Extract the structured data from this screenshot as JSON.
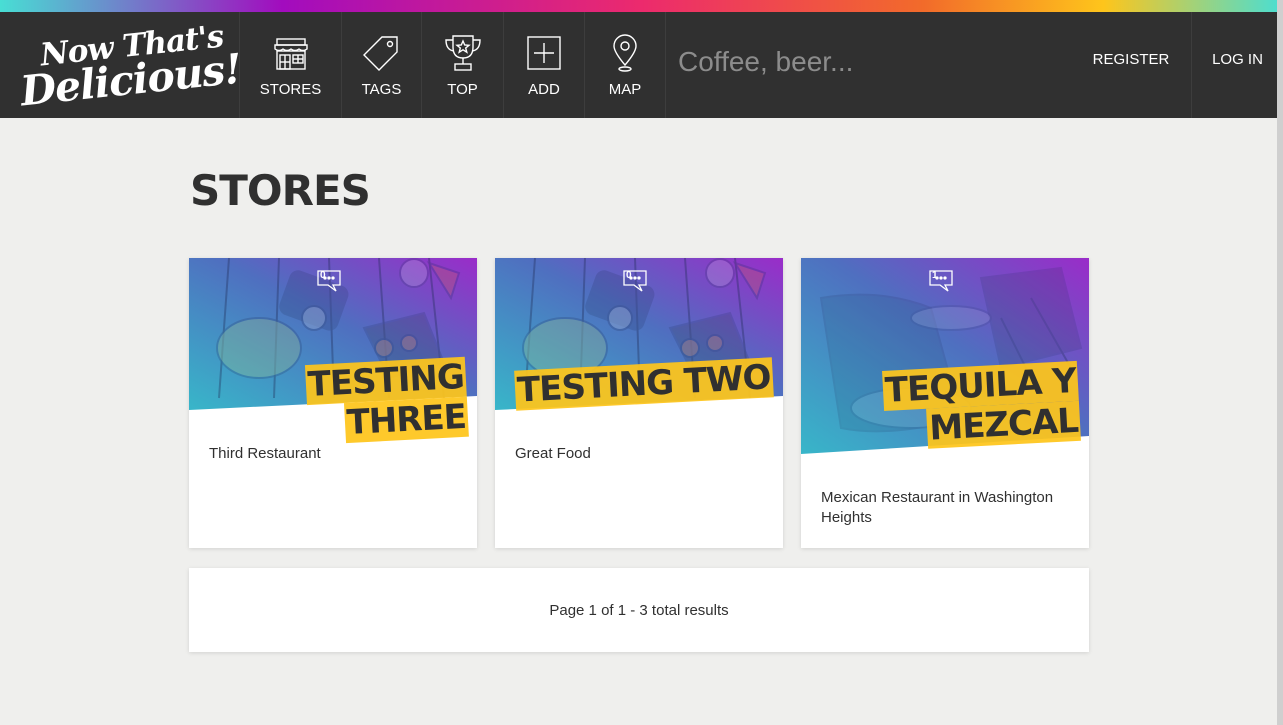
{
  "brand": {
    "logo_line1": "Now That's",
    "logo_line2": "Delicious!"
  },
  "nav": [
    {
      "label": "STORES",
      "icon": "store-icon"
    },
    {
      "label": "TAGS",
      "icon": "tag-icon"
    },
    {
      "label": "TOP",
      "icon": "trophy-icon"
    },
    {
      "label": "ADD",
      "icon": "add-icon"
    },
    {
      "label": "MAP",
      "icon": "map-pin-icon"
    }
  ],
  "search": {
    "placeholder": "Coffee, beer..."
  },
  "auth": {
    "register": "REGISTER",
    "login": "LOG IN"
  },
  "page": {
    "title": "STORES"
  },
  "stores": [
    {
      "name": "TESTING THREE",
      "description": "Third Restaurant",
      "comments": "0"
    },
    {
      "name": "TESTING TWO",
      "description": "Great Food",
      "comments": "0"
    },
    {
      "name": "TEQUILA Y MEZCAL",
      "description": "Mexican Restaurant in Washington Heights",
      "comments": "1"
    }
  ],
  "pagination": {
    "text": "Page 1 of 1 - 3 total results"
  },
  "colors": {
    "nav_bg": "#303030",
    "accent_yellow": "#fec51b",
    "page_bg": "#efefed"
  }
}
